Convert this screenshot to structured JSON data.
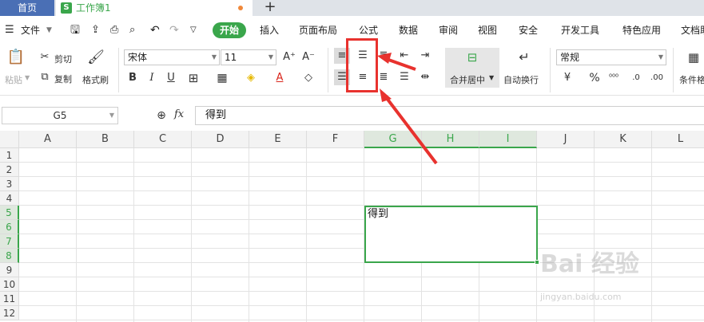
{
  "tabs": {
    "home": "首页",
    "workbook": "工作簿1",
    "workbook_badge": "S",
    "add": "+"
  },
  "menu": {
    "file": "文件",
    "items": [
      "开始",
      "插入",
      "页面布局",
      "公式",
      "数据",
      "审阅",
      "视图",
      "安全",
      "开发工具",
      "特色应用",
      "文档助"
    ]
  },
  "ribbon": {
    "paste": "粘贴",
    "cut": "剪切",
    "copy": "复制",
    "format_painter": "格式刷",
    "font_name": "宋体",
    "font_size": "11",
    "merge_center": "合并居中",
    "wrap_text": "自动换行",
    "number_format": "常规",
    "conditional": "条件格",
    "bold": "B",
    "italic": "I",
    "underline": "U",
    "percent": "%"
  },
  "formula_bar": {
    "cell_ref": "G5",
    "fx": "fx",
    "content": "得到"
  },
  "columns": [
    "A",
    "B",
    "C",
    "D",
    "E",
    "F",
    "G",
    "H",
    "I",
    "J",
    "K",
    "L"
  ],
  "rows": [
    "1",
    "2",
    "3",
    "4",
    "5",
    "6",
    "7",
    "8",
    "9",
    "10",
    "11",
    "12"
  ],
  "selected_cell_text": "得到",
  "watermark": {
    "brand": "Bai 经验",
    "url": "jingyan.baidu.com"
  },
  "colors": {
    "accent": "#3aa64b",
    "annotation": "#e8322e",
    "tab_home": "#4a6fb5"
  }
}
